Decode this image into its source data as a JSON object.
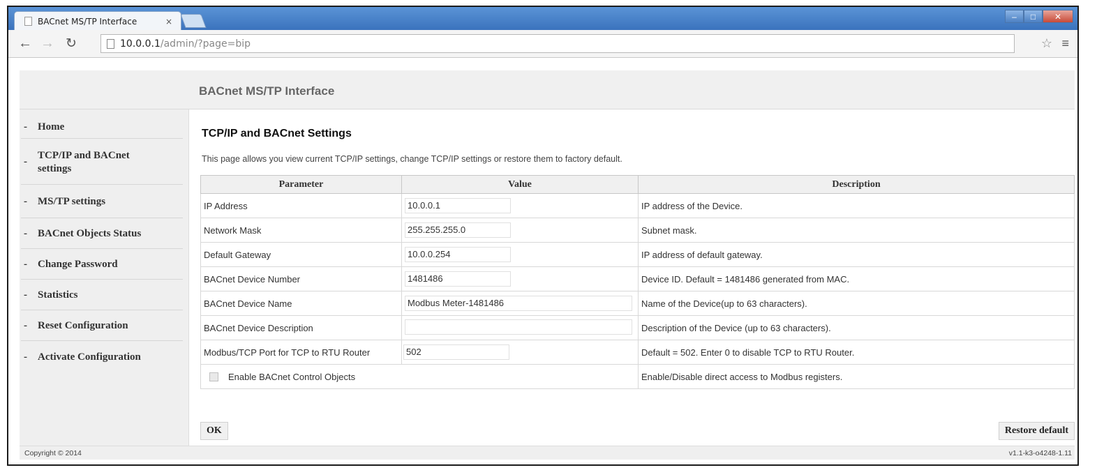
{
  "browser": {
    "tab_title": "BACnet MS/TP Interface",
    "tab_close": "×",
    "url_host": "10.0.0.1",
    "url_path": "/admin/?page=bip"
  },
  "header": {
    "title": "BACnet MS/TP Interface"
  },
  "sidebar": {
    "items": [
      {
        "label": "Home"
      },
      {
        "label": "TCP/IP and BACnet settings"
      },
      {
        "label": "MS/TP settings"
      },
      {
        "label": "BACnet Objects Status"
      },
      {
        "label": "Change Password"
      },
      {
        "label": "Statistics"
      },
      {
        "label": "Reset Configuration"
      },
      {
        "label": "Activate Configuration"
      }
    ]
  },
  "main": {
    "title": "TCP/IP and BACnet Settings",
    "intro": "This page allows you view current TCP/IP settings, change TCP/IP settings or restore them to factory default.",
    "columns": [
      "Parameter",
      "Value",
      "Description"
    ],
    "rows": [
      {
        "param": "IP Address",
        "value": "10.0.0.1",
        "desc": "IP address of the Device."
      },
      {
        "param": "Network Mask",
        "value": "255.255.255.0",
        "desc": "Subnet mask."
      },
      {
        "param": "Default Gateway",
        "value": "10.0.0.254",
        "desc": "IP address of default gateway."
      },
      {
        "param": "BACnet Device Number",
        "value": "1481486",
        "desc": "Device ID. Default = 1481486 generated from MAC."
      },
      {
        "param": "BACnet Device Name",
        "value": "Modbus Meter-1481486",
        "desc": "Name of the Device(up to 63 characters)."
      },
      {
        "param": "BACnet Device Description",
        "value": "",
        "desc": "Description of the Device (up to 63 characters)."
      },
      {
        "param": "Modbus/TCP Port for TCP to RTU Router",
        "value": "502",
        "desc": "Default = 502. Enter 0 to disable TCP to RTU Router."
      }
    ],
    "checkbox": {
      "label": "Enable BACnet Control Objects",
      "checked": false,
      "desc": "Enable/Disable direct access to Modbus registers."
    },
    "ok_label": "OK",
    "restore_label": "Restore default"
  },
  "footer": {
    "copyright": "Copyright © 2014",
    "version": "v1.1-k3-o4248-1.11"
  }
}
